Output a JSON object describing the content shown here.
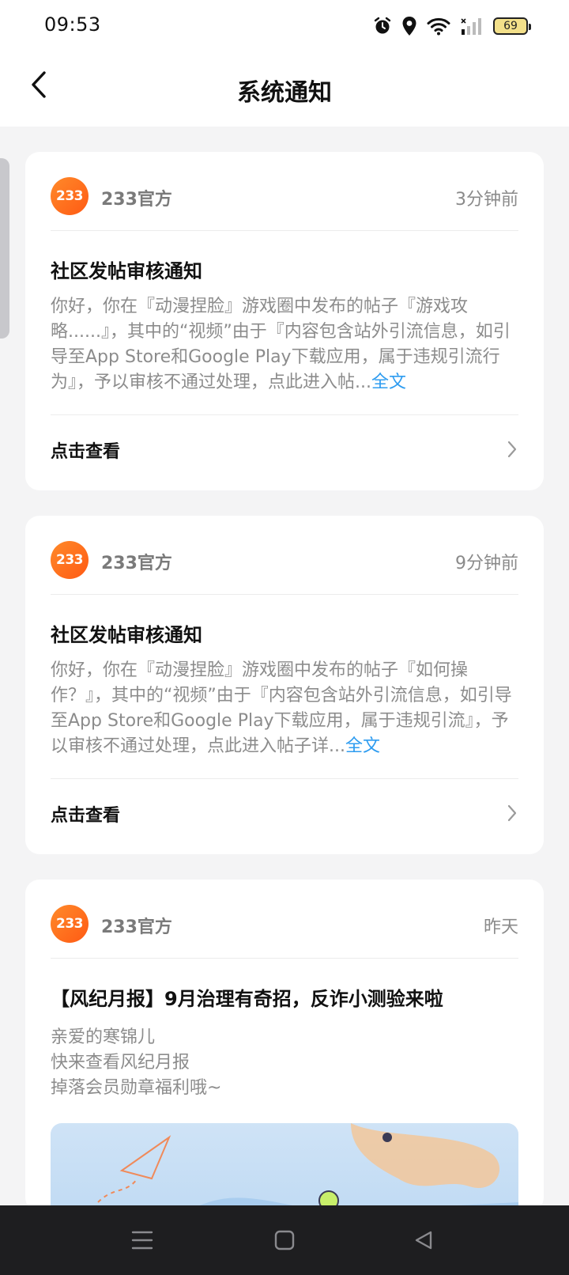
{
  "status_bar": {
    "time": "09:53",
    "battery": "69",
    "icons": [
      "alarm-icon",
      "location-icon",
      "wifi-icon",
      "signal-icon",
      "battery-icon"
    ]
  },
  "header": {
    "title": "系统通知",
    "back_icon": "chevron-left-icon"
  },
  "notifications": [
    {
      "sender": "233官方",
      "logo_text": "233",
      "time": "3分钟前",
      "title": "社区发帖审核通知",
      "body": "你好，你在『动漫捏脸』游戏圈中发布的帖子『游戏攻略......』，其中的“视频”由于『内容包含站外引流信息，如引导至App Store和Google Play下载应用，属于违规引流行为』，予以审核不通过处理，点此进入帖...",
      "full_text_link": "全文",
      "action_label": "点击查看"
    },
    {
      "sender": "233官方",
      "logo_text": "233",
      "time": "9分钟前",
      "title": "社区发帖审核通知",
      "body": "你好，你在『动漫捏脸』游戏圈中发布的帖子『如何操作？』，其中的“视频”由于『内容包含站外引流信息，如引导至App Store和Google Play下载应用，属于违规引流』，予以审核不通过处理，点此进入帖子详...",
      "full_text_link": "全文",
      "action_label": "点击查看"
    },
    {
      "sender": "233官方",
      "logo_text": "233",
      "time": "昨天",
      "title": "【风纪月报】9月治理有奇招，反诈小测验来啦",
      "body_lines": [
        "亲爱的寒锦儿",
        "快来查看风纪月报",
        "掉落会员勋章福利哦~"
      ]
    }
  ],
  "colors": {
    "accent_link": "#2e9cf0",
    "logo_orange": "#ff6a1a",
    "background": "#f4f4f5"
  }
}
